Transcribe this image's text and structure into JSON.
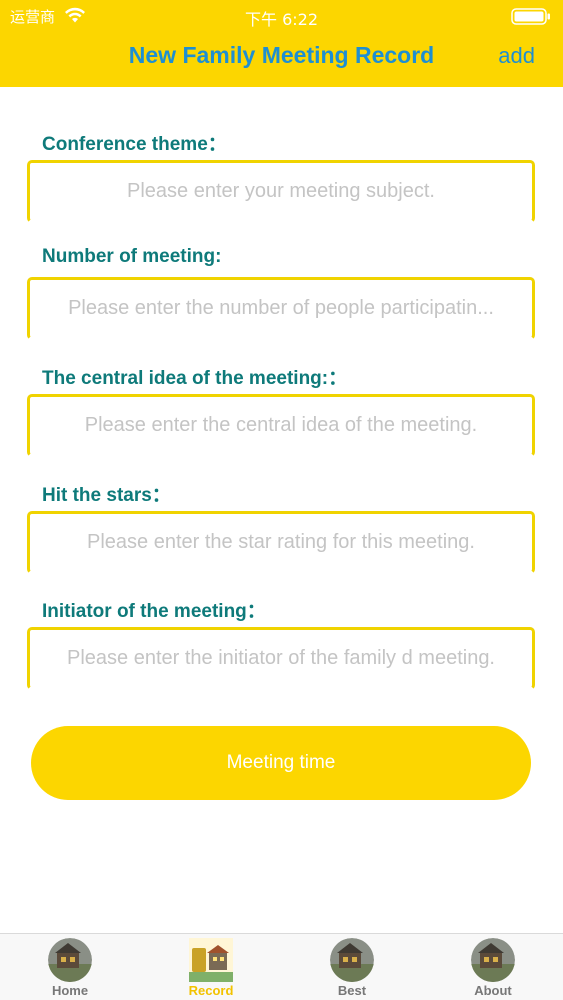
{
  "status_bar": {
    "carrier": "运营商",
    "time": "下午 6:22"
  },
  "nav": {
    "title": "New Family Meeting Record",
    "add_label": "add"
  },
  "form": {
    "fields": [
      {
        "label": "Conference theme：",
        "placeholder": "Please enter your meeting subject."
      },
      {
        "label": "Number of meeting:",
        "placeholder": "Please enter the number of people participatin..."
      },
      {
        "label": "The central idea of the meeting:：",
        "placeholder": "Please enter the central idea of the meeting."
      },
      {
        "label": "Hit the stars：",
        "placeholder": "Please enter the star rating for this meeting."
      },
      {
        "label": "Initiator of the meeting：",
        "placeholder": "Please enter the initiator of the family d meeting."
      }
    ],
    "meeting_time_label": "Meeting time"
  },
  "tabbar": {
    "tabs": [
      {
        "label": "Home",
        "icon": "house-thumbnail-icon",
        "active": false
      },
      {
        "label": "Record",
        "icon": "family-meeting-notebook-icon",
        "active": true
      },
      {
        "label": "Best",
        "icon": "house-thumbnail-icon",
        "active": false
      },
      {
        "label": "About",
        "icon": "house-thumbnail-icon",
        "active": false
      }
    ]
  },
  "colors": {
    "accent_yellow": "#FCD600",
    "title_blue": "#1E8FD2",
    "label_teal": "#0E7A7A",
    "active_tab": "#F2C200"
  }
}
